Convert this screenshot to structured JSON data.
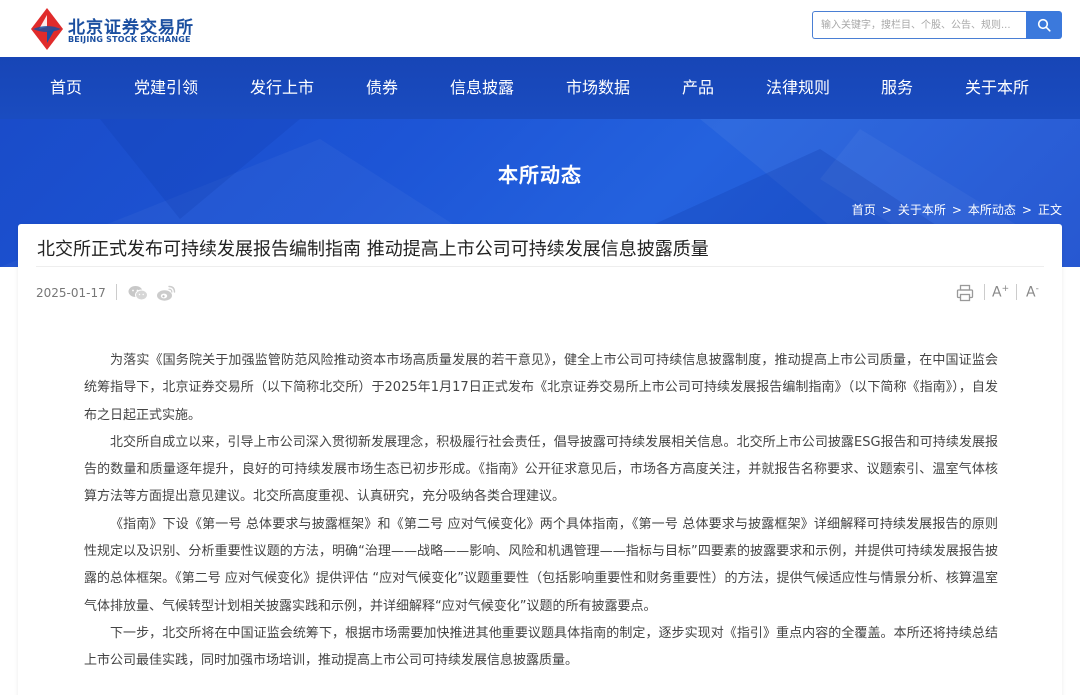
{
  "header": {
    "logo_cn": "北京证券交易所",
    "logo_en": "BEIJING STOCK EXCHANGE",
    "search_placeholder": "输入关键字，搜栏目、个股、公告、规则...",
    "search_icon": "search-icon",
    "brand_colors": {
      "blue": "#1b4fa0",
      "red": "#e02b2b",
      "nav": "#1745b6"
    }
  },
  "nav": {
    "items": [
      {
        "label": "首页"
      },
      {
        "label": "党建引领"
      },
      {
        "label": "发行上市"
      },
      {
        "label": "债券"
      },
      {
        "label": "信息披露"
      },
      {
        "label": "市场数据"
      },
      {
        "label": "产品"
      },
      {
        "label": "法律规则"
      },
      {
        "label": "服务"
      },
      {
        "label": "关于本所"
      }
    ]
  },
  "banner": {
    "title": "本所动态",
    "breadcrumb": [
      "首页",
      "关于本所",
      "本所动态",
      "正文"
    ],
    "breadcrumb_sep": ">"
  },
  "article": {
    "title": "北交所正式发布可持续发展报告编制指南 推动提高上市公司可持续发展信息披露质量",
    "date": "2025-01-17",
    "share_icons": [
      "wechat-icon",
      "weibo-icon"
    ],
    "tools": {
      "print_icon": "print-icon",
      "font_increase": "A",
      "font_increase_sup": "+",
      "font_decrease": "A",
      "font_decrease_sup": "-"
    },
    "paragraphs": [
      "为落实《国务院关于加强监管防范风险推动资本市场高质量发展的若干意见》，健全上市公司可持续信息披露制度，推动提高上市公司质量，在中国证监会统筹指导下，北京证券交易所（以下简称北交所）于2025年1月17日正式发布《北京证券交易所上市公司可持续发展报告编制指南》（以下简称《指南》），自发布之日起正式实施。",
      "北交所自成立以来，引导上市公司深入贯彻新发展理念，积极履行社会责任，倡导披露可持续发展相关信息。北交所上市公司披露ESG报告和可持续发展报告的数量和质量逐年提升，良好的可持续发展市场生态已初步形成。《指南》公开征求意见后，市场各方高度关注，并就报告名称要求、议题索引、温室气体核算方法等方面提出意见建议。北交所高度重视、认真研究，充分吸纳各类合理建议。",
      "《指南》下设《第一号 总体要求与披露框架》和《第二号 应对气候变化》两个具体指南，《第一号 总体要求与披露框架》详细解释可持续发展报告的原则性规定以及识别、分析重要性议题的方法，明确“治理——战略——影响、风险和机遇管理——指标与目标”四要素的披露要求和示例，并提供可持续发展报告披露的总体框架。《第二号 应对气候变化》提供评估 “应对气候变化”议题重要性（包括影响重要性和财务重要性）的方法，提供气候适应性与情景分析、核算温室气体排放量、气候转型计划相关披露实践和示例，并详细解释“应对气候变化”议题的所有披露要点。",
      "下一步，北交所将在中国证监会统筹下，根据市场需要加快推进其他重要议题具体指南的制定，逐步实现对《指引》重点内容的全覆盖。本所还将持续总结上市公司最佳实践，同时加强市场培训，推动提高上市公司可持续发展信息披露质量。"
    ]
  }
}
